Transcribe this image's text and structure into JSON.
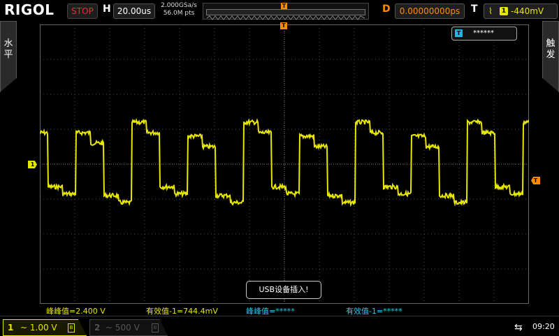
{
  "header": {
    "brand": "RIGOL",
    "run_state": "STOP",
    "horizontal_label": "H",
    "timebase": "20.00us",
    "sample_rate": "2.000GSa/s",
    "memory_depth": "56.0M pts",
    "delay_label": "D",
    "delay_value": "0.00000000ps",
    "trigger_label": "T",
    "trigger_channel": "1",
    "trigger_level": "-440mV"
  },
  "side_tabs": {
    "left": "水平",
    "right": "触发"
  },
  "trigger_status": {
    "icon_letter": "T",
    "value": "******"
  },
  "markers": {
    "trigger_position": "T",
    "channel1": "1",
    "trigger_level": "T"
  },
  "message": "USB设备插入!",
  "measurements": [
    {
      "text": "峰峰值=2.400 V",
      "color": "yellow"
    },
    {
      "text": "有效值-1=744.4mV",
      "color": "yellow"
    },
    {
      "text": "峰峰值=*****",
      "color": "cyan"
    },
    {
      "text": "有效值-1=*****",
      "color": "cyan"
    }
  ],
  "channels": [
    {
      "number": "1",
      "coupling": "~",
      "scale": "1.00 V",
      "bw": "B",
      "active": true
    },
    {
      "number": "2",
      "coupling": "~",
      "scale": "500 V",
      "bw": "B",
      "active": false
    }
  ],
  "status": {
    "usb_icon": "usb-icon",
    "time": "09:20"
  },
  "colors": {
    "ch1": "#e6e600",
    "trigger": "#ff8c00",
    "stop": "#e53030",
    "measure_cyan": "#29c8f0"
  },
  "waveform": {
    "high_levels_div": [
      1.2,
      0.9,
      1.2,
      0.8,
      1.2,
      0.8,
      1.2,
      0.8,
      1.2
    ],
    "low_levels_div": [
      -0.65,
      -0.9,
      -0.65,
      -0.9,
      -0.65,
      -0.9,
      -0.65,
      -0.9,
      -0.65
    ]
  }
}
